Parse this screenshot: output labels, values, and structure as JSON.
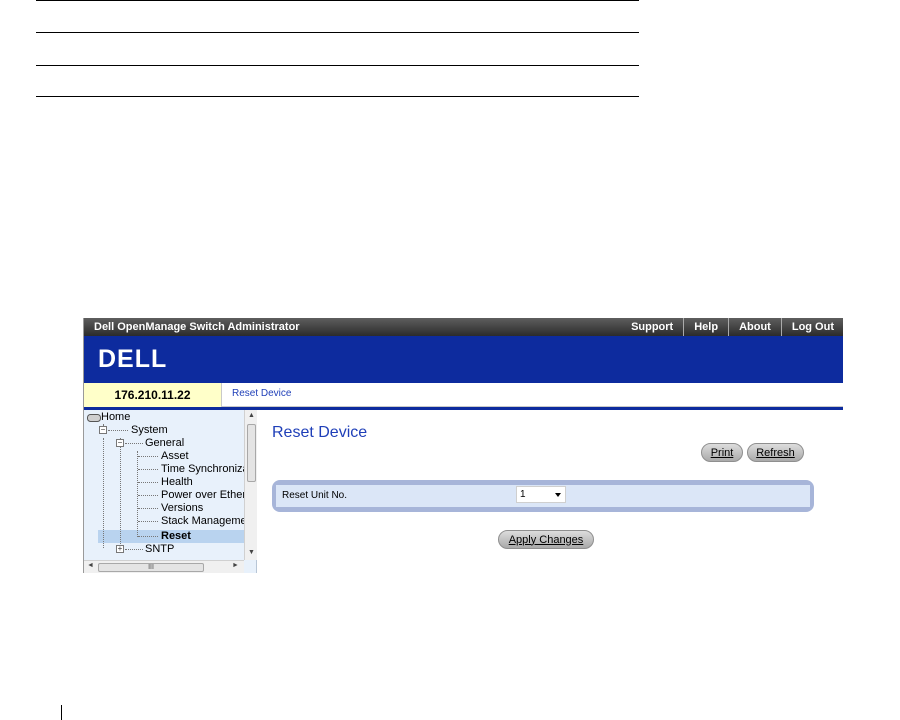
{
  "app": {
    "title": "Dell OpenManage Switch Administrator",
    "links": [
      "Support",
      "Help",
      "About",
      "Log Out"
    ],
    "logo_text": "DELL",
    "ip": "176.210.11.22",
    "breadcrumb": "Reset Device"
  },
  "tree": {
    "home": "Home",
    "system": "System",
    "general": "General",
    "items": [
      "Asset",
      "Time Synchroniza",
      "Health",
      "Power over Ethen",
      "Versions",
      "Stack Manageme",
      "Reset"
    ],
    "sntp": "SNTP",
    "selected": "Reset",
    "scroll_h_grip": "III"
  },
  "main": {
    "title": "Reset Device",
    "print_label": "Print",
    "refresh_label": "Refresh",
    "field_label": "Reset Unit No.",
    "field_value": "1",
    "apply_label": "Apply Changes"
  },
  "colors": {
    "banner": "#0d2b9e",
    "ip_bg": "#ffffc9",
    "link": "#1f3fb8",
    "form_border": "#a7b5d9",
    "form_bg": "#dbe6f7"
  }
}
